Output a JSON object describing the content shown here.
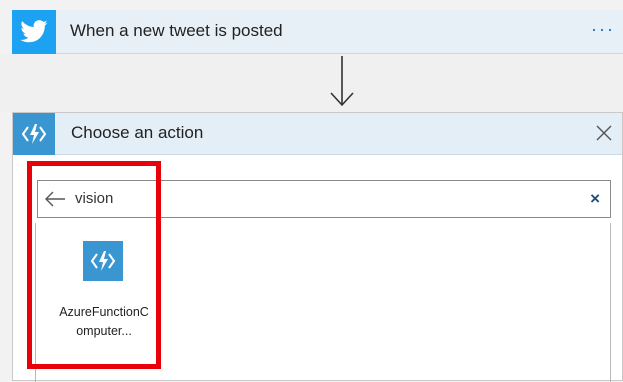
{
  "trigger": {
    "title": "When a new tweet is posted",
    "more_label": "···",
    "icon": "twitter-bird-icon",
    "color": "#1da1f2"
  },
  "connector": {
    "icon": "down-arrow-icon"
  },
  "action": {
    "title": "Choose an action",
    "icon": "azure-function-icon",
    "close_icon": "close-icon"
  },
  "search": {
    "value": "vision",
    "back_icon": "back-arrow-icon",
    "clear_label": "×"
  },
  "results": [
    {
      "label": "AzureFunctionComputer...",
      "icon": "azure-function-icon",
      "color": "#3a96d1"
    }
  ],
  "highlight": {
    "color": "#e8000b"
  }
}
